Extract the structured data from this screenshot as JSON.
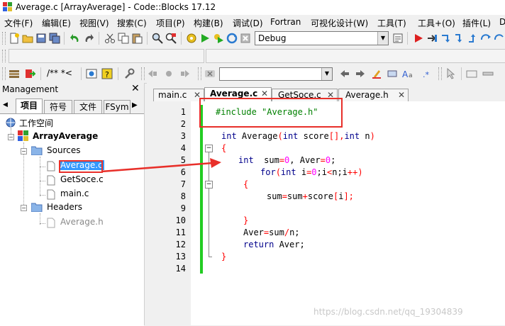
{
  "window": {
    "title": "Average.c [ArrayAverage] - Code::Blocks 17.12"
  },
  "menu": [
    "文件(F)",
    "编辑(E)",
    "视图(V)",
    "搜索(C)",
    "项目(P)",
    "构建(B)",
    "调试(D)",
    "Fortran",
    "可视化设计(W)",
    "工具(T)",
    "工具+(O)",
    "插件(L)",
    "D"
  ],
  "toolbar": {
    "build_target": "Debug",
    "comment_label": "/** *<"
  },
  "management": {
    "title": "Management",
    "close": "✕",
    "tabs": [
      "项目",
      "符号",
      "文件",
      "FSym"
    ],
    "nav_arrow": "▶",
    "tree": {
      "workspace": "工作空间",
      "project": "ArrayAverage",
      "sources_folder": "Sources",
      "sources": [
        "Average.c",
        "GetSoce.c",
        "main.c"
      ],
      "headers_folder": "Headers",
      "headers": [
        "Average.h"
      ]
    }
  },
  "editor": {
    "tabs": [
      "main.c",
      "Average.c",
      "GetSoce.c",
      "Average.h"
    ],
    "active_tab": "Average.c",
    "line_numbers": [
      "1",
      "2",
      "3",
      "4",
      "5",
      "6",
      "7",
      "8",
      "9",
      "10",
      "11",
      "12",
      "13",
      "14"
    ]
  },
  "code": {
    "l1": "#include \"Average.h\"",
    "l3_kw1": "int",
    "l3_name": " Average",
    "l3_p1": "(",
    "l3_kw2": "int",
    "l3_mid": " score",
    "l3_p2": "[],",
    "l3_kw3": "int",
    "l3_end": " n",
    "l3_p3": ")",
    "l4": "{",
    "l5_kw": "int",
    "l5_a": "  sum",
    "l5_eq1": "=",
    "l5_n1": "0",
    "l5_b": ", Aver",
    "l5_eq2": "=",
    "l5_n2": "0",
    "l5_c": ";",
    "l6_kw1": "for",
    "l6_p": "(",
    "l6_kw2": "int",
    "l6_a": " i",
    "l6_eq": "=",
    "l6_n": "0",
    "l6_b": ";i",
    "l6_lt": "<",
    "l6_c": "n;i",
    "l6_inc": "++",
    "l6_close": ")",
    "l7": "{",
    "l8_a": "sum",
    "l8_eq": "=",
    "l8_b": "sum",
    "l8_plus": "+",
    "l8_c": "score",
    "l8_br1": "[",
    "l8_d": "i",
    "l8_br2": "];",
    "l10": "}",
    "l11_a": "Aver",
    "l11_eq": "=",
    "l11_b": "sum",
    "l11_div": "/",
    "l11_c": "n;",
    "l12_kw": "return",
    "l12_a": " Aver;",
    "l13": "}"
  },
  "colors": {
    "annotation": "#e8302a",
    "keyword": "#00008b",
    "preprocessor": "#008000",
    "operator": "#ff0000",
    "number": "#ff00ff",
    "change_bar": "#22cc22",
    "selection": "#3399ff"
  },
  "watermark": "https://blog.csdn.net/qq_19304839"
}
